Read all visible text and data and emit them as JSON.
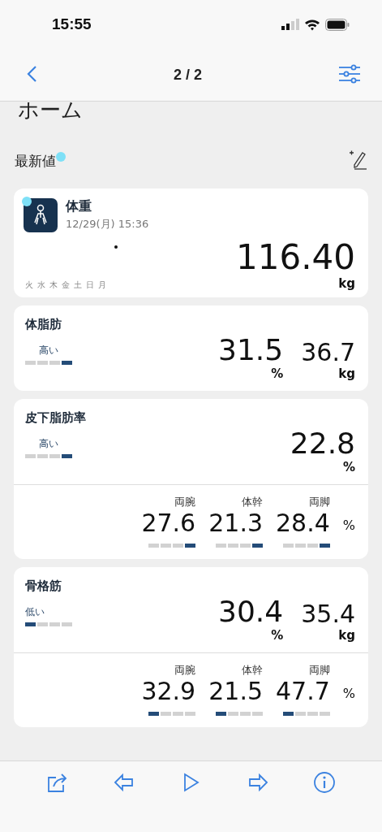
{
  "status_bar": {
    "time": "15:55"
  },
  "nav": {
    "title": "2 / 2"
  },
  "page_title": "ホーム",
  "section": {
    "title": "最新値",
    "new_dot": true
  },
  "weight": {
    "title": "体重",
    "date": "12/29(月) 15:36",
    "new_dot": true,
    "weekdays": [
      "火",
      "水",
      "木",
      "金",
      "土",
      "日",
      "月"
    ],
    "value": "116.40",
    "unit": "kg"
  },
  "metrics": [
    {
      "title": "体脂肪",
      "band_label": "高い",
      "segments": [
        {
          "on": false
        },
        {
          "on": false
        },
        {
          "on": false
        },
        {
          "on": true
        }
      ],
      "values": [
        {
          "value": "31.5",
          "unit": "%"
        },
        {
          "value": "36.7",
          "unit": "kg"
        }
      ]
    },
    {
      "title": "皮下脂肪率",
      "band_label": "高い",
      "segments": [
        {
          "on": false
        },
        {
          "on": false
        },
        {
          "on": false
        },
        {
          "on": true
        }
      ],
      "values": [
        {
          "value": "22.8",
          "unit": "%"
        }
      ],
      "parts": [
        {
          "label": "両腕",
          "value": "27.6",
          "segments": [
            {
              "on": false
            },
            {
              "on": false
            },
            {
              "on": false
            },
            {
              "on": true
            }
          ]
        },
        {
          "label": "体幹",
          "value": "21.3",
          "segments": [
            {
              "on": false
            },
            {
              "on": false
            },
            {
              "on": false
            },
            {
              "on": true
            }
          ]
        },
        {
          "label": "両脚",
          "value": "28.4",
          "segments": [
            {
              "on": false
            },
            {
              "on": false
            },
            {
              "on": false
            },
            {
              "on": true
            }
          ]
        }
      ],
      "parts_unit": "%"
    },
    {
      "title": "骨格筋",
      "band_label": "低い",
      "segments": [
        {
          "on": true
        },
        {
          "on": false
        },
        {
          "on": false
        },
        {
          "on": false
        }
      ],
      "values": [
        {
          "value": "30.4",
          "unit": "%"
        },
        {
          "value": "35.4",
          "unit": "kg"
        }
      ],
      "parts": [
        {
          "label": "両腕",
          "value": "32.9",
          "segments": [
            {
              "on": true
            },
            {
              "on": false
            },
            {
              "on": false
            },
            {
              "on": false
            }
          ]
        },
        {
          "label": "体幹",
          "value": "21.5",
          "segments": [
            {
              "on": true
            },
            {
              "on": false
            },
            {
              "on": false
            },
            {
              "on": false
            }
          ]
        },
        {
          "label": "両脚",
          "value": "47.7",
          "segments": [
            {
              "on": true
            },
            {
              "on": false
            },
            {
              "on": false
            },
            {
              "on": false
            }
          ]
        }
      ],
      "parts_unit": "%"
    }
  ]
}
